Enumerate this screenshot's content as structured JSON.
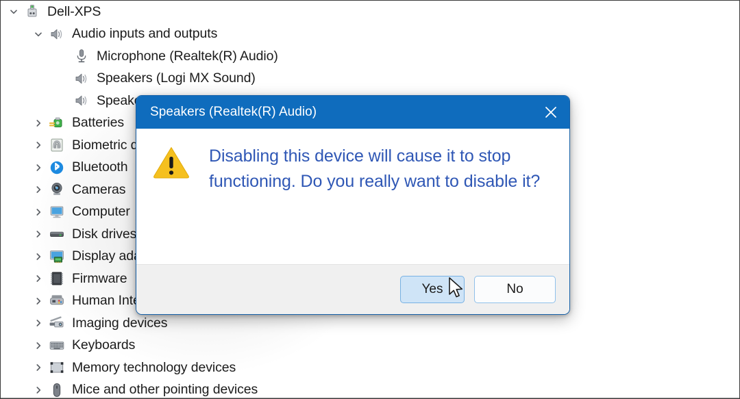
{
  "tree": {
    "items": [
      {
        "label": "Dell-XPS",
        "depth": 0,
        "expander": "chevron-down",
        "icon": "computer-device-icon"
      },
      {
        "label": "Audio inputs and outputs",
        "depth": 1,
        "expander": "chevron-down",
        "icon": "speaker-icon"
      },
      {
        "label": "Microphone (Realtek(R) Audio)",
        "depth": 2,
        "expander": "none",
        "icon": "microphone-icon"
      },
      {
        "label": "Speakers (Logi MX Sound)",
        "depth": 2,
        "expander": "none",
        "icon": "speaker-icon"
      },
      {
        "label": "Speakers (Realtek(R) Audio)",
        "depth": 2,
        "expander": "none",
        "icon": "speaker-icon"
      },
      {
        "label": "Batteries",
        "depth": 1,
        "expander": "chevron-right",
        "icon": "battery-icon"
      },
      {
        "label": "Biometric devices",
        "depth": 1,
        "expander": "chevron-right",
        "icon": "fingerprint-icon"
      },
      {
        "label": "Bluetooth",
        "depth": 1,
        "expander": "chevron-right",
        "icon": "bluetooth-icon"
      },
      {
        "label": "Cameras",
        "depth": 1,
        "expander": "chevron-right",
        "icon": "camera-icon"
      },
      {
        "label": "Computer",
        "depth": 1,
        "expander": "chevron-right",
        "icon": "monitor-icon"
      },
      {
        "label": "Disk drives",
        "depth": 1,
        "expander": "chevron-right",
        "icon": "disk-drive-icon"
      },
      {
        "label": "Display adapters",
        "depth": 1,
        "expander": "chevron-right",
        "icon": "display-adapter-icon"
      },
      {
        "label": "Firmware",
        "depth": 1,
        "expander": "chevron-right",
        "icon": "firmware-chip-icon"
      },
      {
        "label": "Human Interface Devices",
        "depth": 1,
        "expander": "chevron-right",
        "icon": "hid-gamepad-icon"
      },
      {
        "label": "Imaging devices",
        "depth": 1,
        "expander": "chevron-right",
        "icon": "scanner-icon"
      },
      {
        "label": "Keyboards",
        "depth": 1,
        "expander": "chevron-right",
        "icon": "keyboard-icon"
      },
      {
        "label": "Memory technology devices",
        "depth": 1,
        "expander": "chevron-right",
        "icon": "memory-card-icon"
      },
      {
        "label": "Mice and other pointing devices",
        "depth": 1,
        "expander": "chevron-right",
        "icon": "mouse-icon"
      }
    ]
  },
  "dialog": {
    "title": "Speakers (Realtek(R) Audio)",
    "close_label": "×",
    "icon": "warning-triangle-icon",
    "message": "Disabling this device will cause it to stop functioning. Do you really want to disable it?",
    "buttons": {
      "yes_label": "Yes",
      "no_label": "No"
    }
  },
  "colors": {
    "titlebar_blue": "#0f6cbd",
    "message_blue": "#2f57b5",
    "warning_yellow": "#f5c01f",
    "yes_button_fill": "#cfe4f7",
    "yes_button_border": "#77b1e3",
    "no_button_border": "#8fc0ea",
    "dialog_border": "#1560a8",
    "footer_gray": "#f0f0f0"
  },
  "cursor": {
    "name": "mouse-pointer"
  }
}
